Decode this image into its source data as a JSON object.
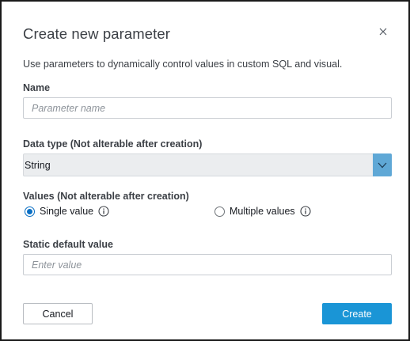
{
  "dialog": {
    "title": "Create new parameter",
    "description": "Use parameters to dynamically control values in custom SQL and visual.",
    "close_icon": "close-icon"
  },
  "name_field": {
    "label": "Name",
    "placeholder": "Parameter name",
    "value": ""
  },
  "data_type": {
    "label": "Data type (Not alterable after creation)",
    "selected": "String",
    "arrow_icon": "chevron-down-icon"
  },
  "values": {
    "label": "Values (Not alterable after creation)",
    "options": [
      {
        "label": "Single value",
        "checked": true,
        "icon": "info-icon"
      },
      {
        "label": "Multiple values",
        "checked": false,
        "icon": "info-icon"
      }
    ]
  },
  "static_default": {
    "label": "Static default value",
    "placeholder": "Enter value",
    "value": ""
  },
  "buttons": {
    "cancel": "Cancel",
    "create": "Create"
  },
  "colors": {
    "primary": "#1a95d6",
    "select_arrow_bg": "#5fa8d6",
    "radio_checked": "#0a6fc4",
    "select_bg": "#ebedef"
  }
}
